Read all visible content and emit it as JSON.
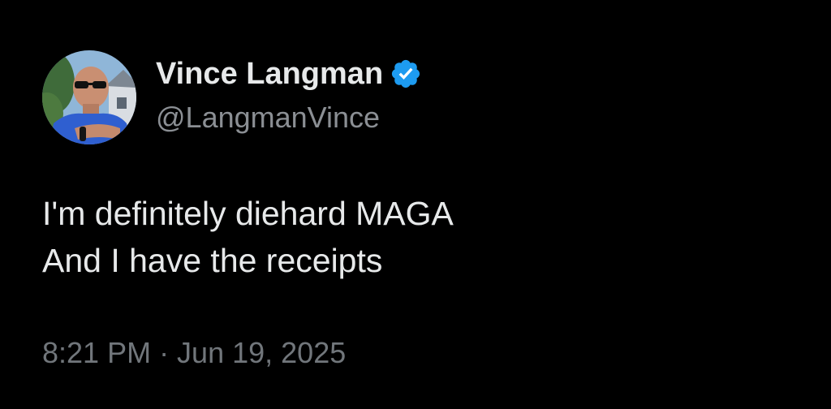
{
  "post": {
    "author": {
      "display_name": "Vince Langman",
      "handle": "@LangmanVince",
      "verified": true,
      "verified_icon": "verified-badge-icon",
      "avatar_icon": "profile-photo-avatar"
    },
    "text_lines": [
      "I'm definitely diehard MAGA",
      "And I have the receipts"
    ],
    "timestamp": "8:21 PM · Jun 19, 2025"
  },
  "colors": {
    "background": "#000000",
    "primary_text": "#e7e9ea",
    "secondary_text": "#71767b",
    "verified_blue": "#1d9bf0"
  }
}
